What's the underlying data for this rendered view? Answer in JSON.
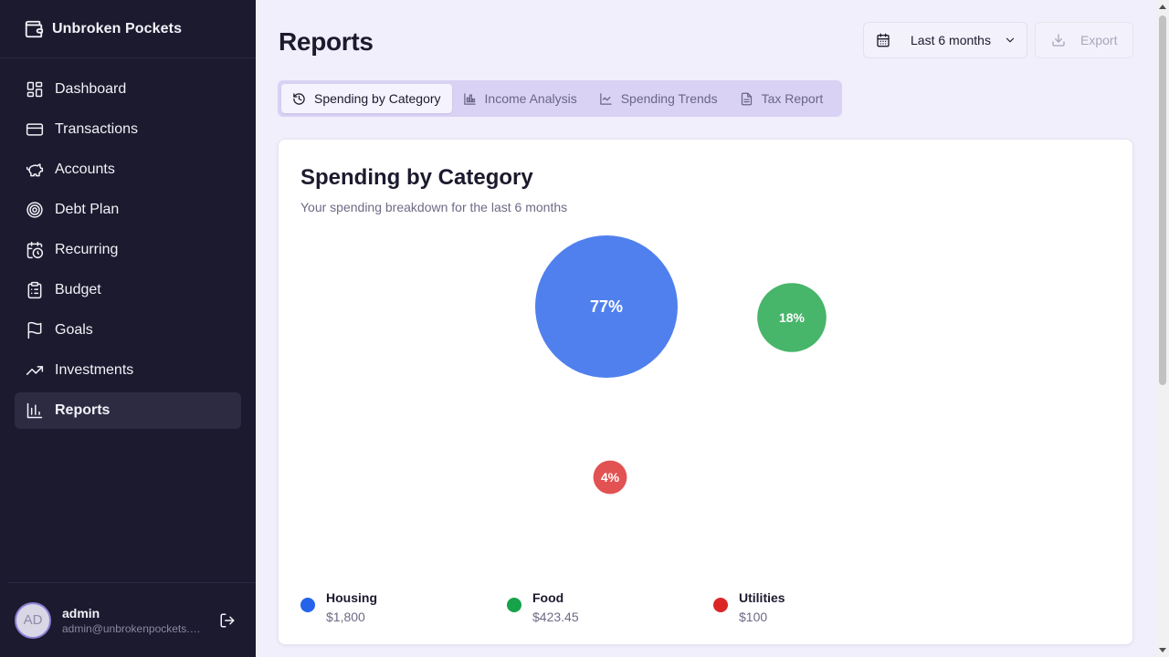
{
  "app": {
    "name": "Unbroken Pockets"
  },
  "sidebar": {
    "items": [
      {
        "label": "Dashboard",
        "icon": "layout-dashboard-icon"
      },
      {
        "label": "Transactions",
        "icon": "credit-card-icon"
      },
      {
        "label": "Accounts",
        "icon": "piggy-bank-icon"
      },
      {
        "label": "Debt Plan",
        "icon": "target-icon"
      },
      {
        "label": "Recurring",
        "icon": "calendar-clock-icon"
      },
      {
        "label": "Budget",
        "icon": "clipboard-list-icon"
      },
      {
        "label": "Goals",
        "icon": "flag-icon"
      },
      {
        "label": "Investments",
        "icon": "trending-up-icon"
      },
      {
        "label": "Reports",
        "icon": "bar-chart-icon",
        "active": true
      }
    ]
  },
  "user": {
    "initials": "AD",
    "name": "admin",
    "email": "admin@unbrokenpockets.com"
  },
  "header": {
    "title": "Reports",
    "range_label": "Last 6 months",
    "export_label": "Export"
  },
  "tabs": [
    {
      "label": "Spending by Category",
      "icon": "history-icon",
      "active": true
    },
    {
      "label": "Income Analysis",
      "icon": "bar-chart-icon"
    },
    {
      "label": "Spending Trends",
      "icon": "line-chart-icon"
    },
    {
      "label": "Tax Report",
      "icon": "file-text-icon"
    }
  ],
  "card": {
    "title": "Spending by Category",
    "subtitle": "Your spending breakdown for the last 6 months"
  },
  "colors": {
    "housing": "#4f80ed",
    "food": "#47b56a",
    "utilities": "#e25252",
    "accent": "#8b7fd6"
  },
  "chart_data": {
    "type": "bubble",
    "categories": [
      "Housing",
      "Food",
      "Utilities"
    ],
    "values": [
      1800,
      423.45,
      100
    ],
    "display_values": [
      "$1,800",
      "$423.45",
      "$100"
    ],
    "percent_labels": [
      "77%",
      "18%",
      "4%"
    ],
    "colors": [
      "#4f80ed",
      "#47b56a",
      "#e25252"
    ]
  }
}
